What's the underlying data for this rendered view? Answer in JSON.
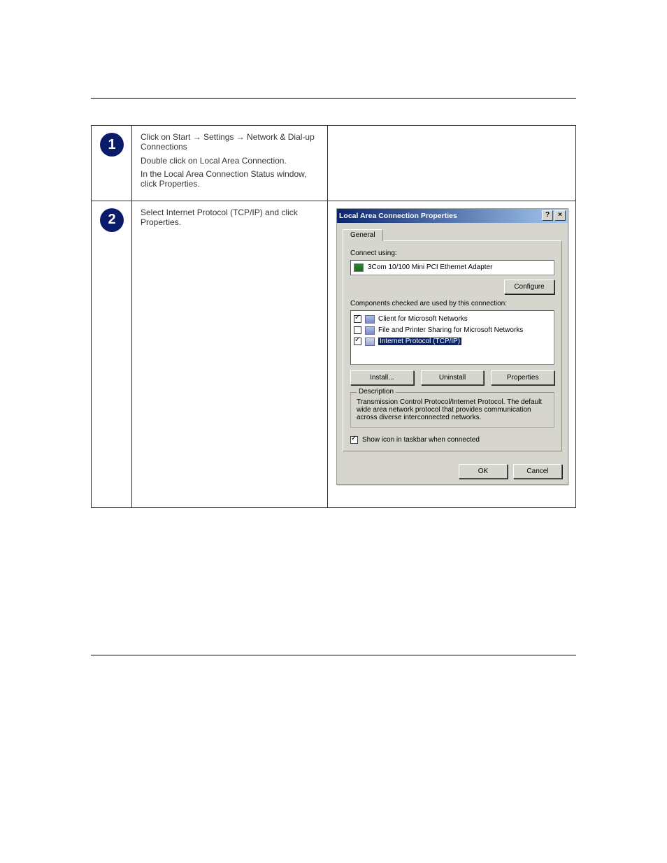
{
  "page": {
    "step1": {
      "badge": "1",
      "line1": "Click on Start → Settings → Network & Dial-up Connections",
      "line2": "Double click on Local Area Connection.",
      "line3": "In the Local Area Connection Status window, click Properties."
    },
    "step2": {
      "badge": "2",
      "line1": "Select Internet Protocol (TCP/IP) and click Properties."
    }
  },
  "dialog": {
    "title": "Local Area Connection Properties",
    "helpGlyph": "?",
    "closeGlyph": "×",
    "tab": "General",
    "connectUsingLabel": "Connect using:",
    "adapter": "3Com 10/100 Mini PCI Ethernet Adapter",
    "configureBtn": "Configure",
    "componentsLabel": "Components checked are used by this connection:",
    "items": [
      {
        "label": "Client for Microsoft Networks",
        "checked": true
      },
      {
        "label": "File and Printer Sharing for Microsoft Networks",
        "checked": false
      },
      {
        "label": "Internet Protocol (TCP/IP)",
        "checked": true,
        "selected": true
      }
    ],
    "installBtn": "Install...",
    "uninstallBtn": "Uninstall",
    "propertiesBtn": "Properties",
    "descriptionLegend": "Description",
    "descriptionText": "Transmission Control Protocol/Internet Protocol. The default wide area network protocol that provides communication across diverse interconnected networks.",
    "showIconLabel": "Show icon in taskbar when connected",
    "okBtn": "OK",
    "cancelBtn": "Cancel"
  }
}
